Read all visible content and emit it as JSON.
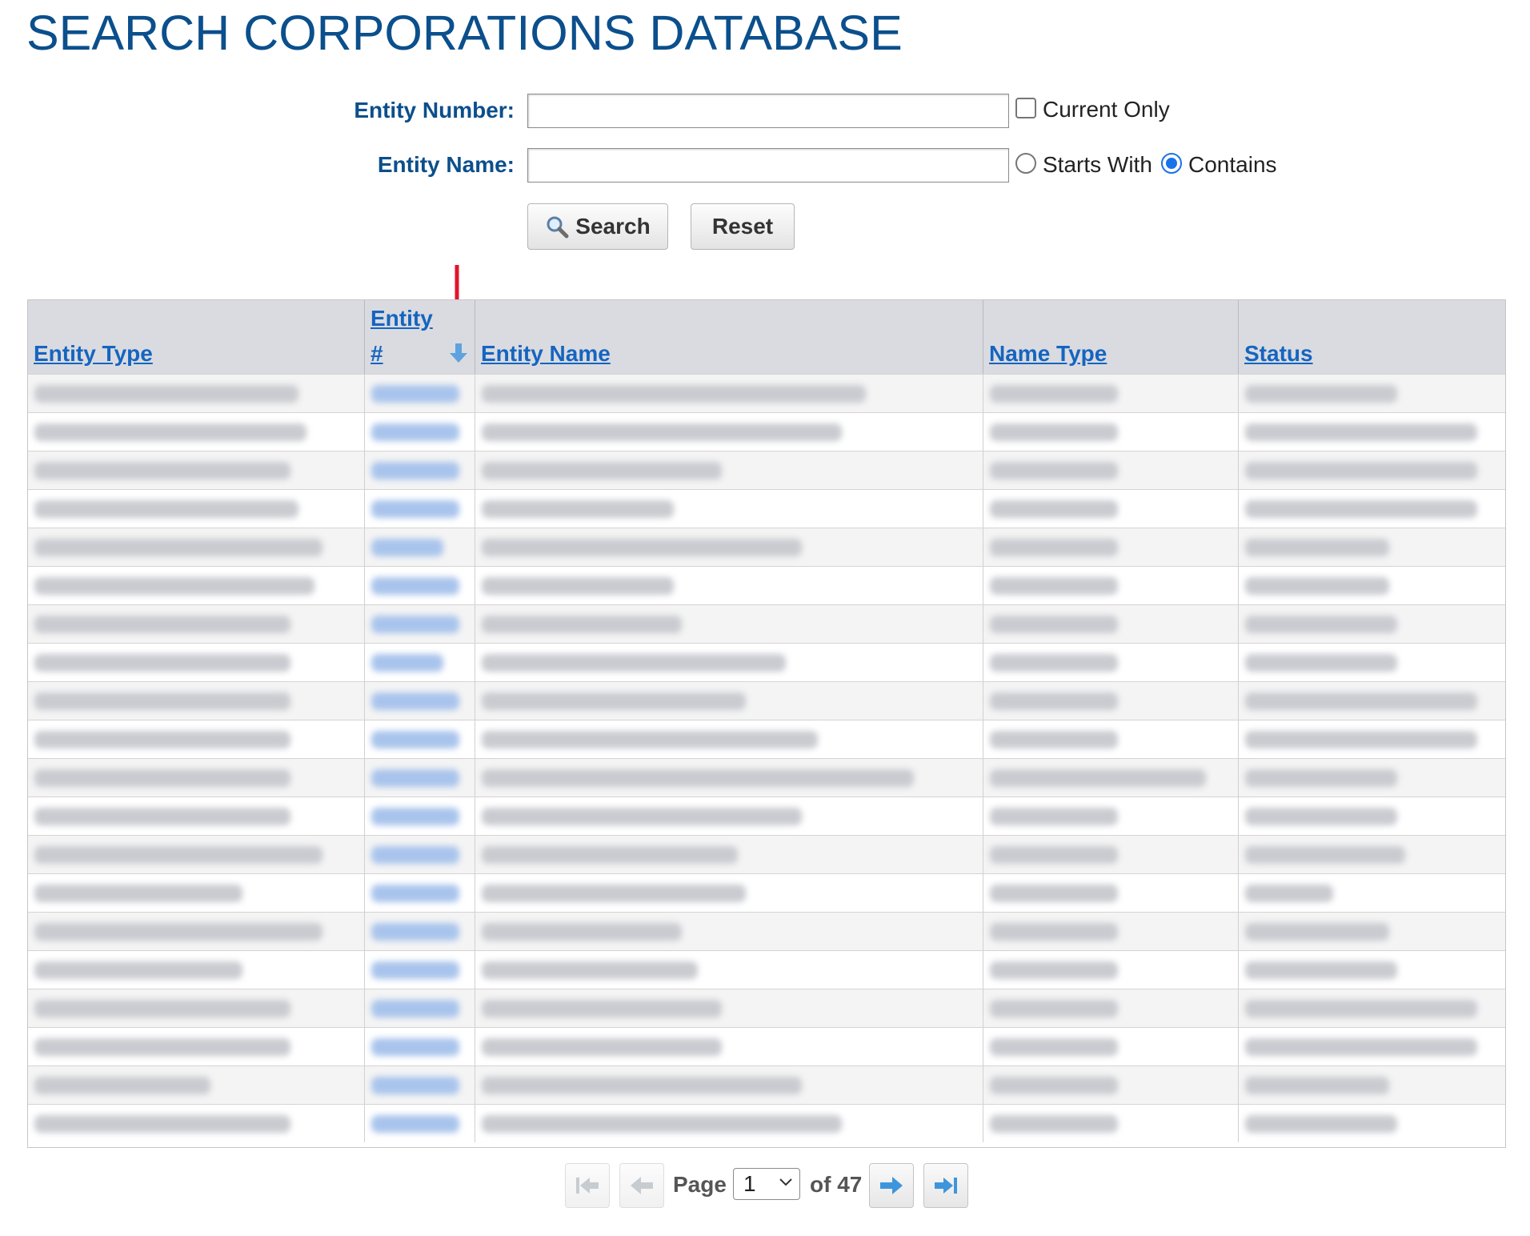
{
  "title": "SEARCH CORPORATIONS DATABASE",
  "form": {
    "entity_number_label": "Entity Number:",
    "entity_number_value": "",
    "current_only_label": "Current Only",
    "current_only_checked": false,
    "entity_name_label": "Entity Name:",
    "entity_name_value": "",
    "starts_with_label": "Starts With",
    "contains_label": "Contains",
    "name_match_selected": "Contains",
    "search_label": "Search",
    "reset_label": "Reset",
    "search_icon": "magnifier-icon"
  },
  "table": {
    "headers": {
      "entity_type": "Entity Type",
      "entity_number_line1": "Entity",
      "entity_number_line2": "#",
      "entity_name": "Entity Name",
      "name_type": "Name Type",
      "status": "Status"
    },
    "sort_indicator": "sort-down-icon",
    "annotation": "red-down-arrow",
    "row_count_visible": 20,
    "rows_redacted": true
  },
  "pager": {
    "page_label": "Page",
    "current_page": "1",
    "of_label": "of 47",
    "total_pages": 47
  },
  "colors": {
    "title": "#0b4f8c",
    "link": "#1565c0",
    "header_bg": "#dadbe0",
    "annotation_arrow": "#e0152b",
    "radio_accent": "#1a73e8"
  }
}
